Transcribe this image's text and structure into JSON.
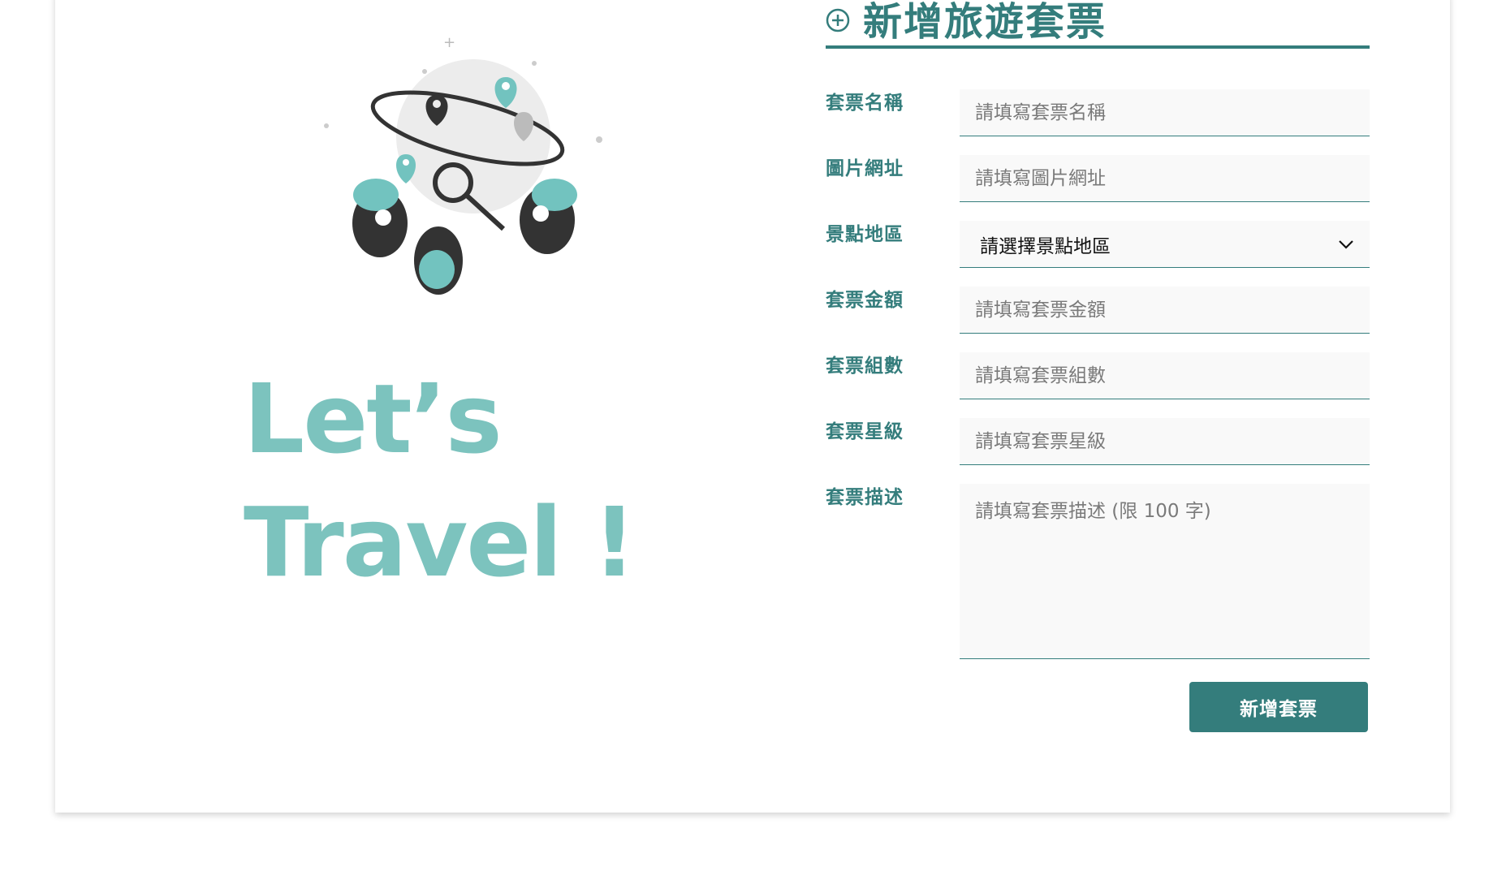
{
  "form": {
    "title": "新增旅遊套票",
    "submit_label": "新增套票",
    "fields": {
      "name": {
        "label": "套票名稱",
        "placeholder": "請填寫套票名稱"
      },
      "image_url": {
        "label": "圖片網址",
        "placeholder": "請填寫圖片網址"
      },
      "region": {
        "label": "景點地區",
        "selected": "請選擇景點地區"
      },
      "price": {
        "label": "套票金額",
        "placeholder": "請填寫套票金額"
      },
      "group": {
        "label": "套票組數",
        "placeholder": "請填寫套票組數"
      },
      "rating": {
        "label": "套票星級",
        "placeholder": "請填寫套票星級"
      },
      "description": {
        "label": "套票描述",
        "placeholder": "請填寫套票描述 (限 100 字)"
      }
    }
  },
  "banner": {
    "slogan_line1": "Let’s",
    "slogan_line2": "Travel !"
  },
  "colors": {
    "accent": "#347d7c",
    "slogan": "#7cc3be",
    "field_bg": "#f9f9f9"
  }
}
